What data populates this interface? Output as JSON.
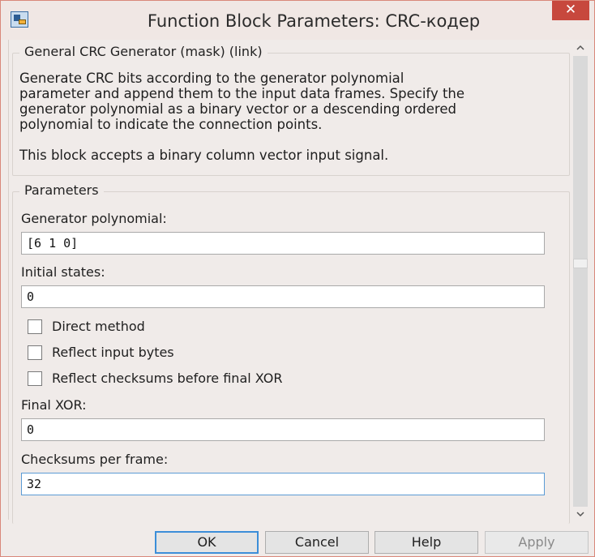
{
  "window": {
    "title": "Function Block Parameters: CRC-кодер",
    "close_label": "✕"
  },
  "mask_group": {
    "title": "General CRC Generator (mask) (link)",
    "description_lines": [
      "Generate CRC bits according to the generator polynomial",
      "parameter and append them to the input data frames. Specify the",
      "generator polynomial as a binary vector or a descending ordered",
      "polynomial to indicate the connection points."
    ],
    "note": "This block accepts a binary column vector input signal."
  },
  "parameters": {
    "title": "Parameters",
    "generator_polynomial": {
      "label": "Generator polynomial:",
      "value": "[6 1 0]"
    },
    "initial_states": {
      "label": "Initial states:",
      "value": "0"
    },
    "direct_method": {
      "label": "Direct method",
      "checked": false
    },
    "reflect_input_bytes": {
      "label": "Reflect input bytes",
      "checked": false
    },
    "reflect_checksums": {
      "label": "Reflect checksums before final XOR",
      "checked": false
    },
    "final_xor": {
      "label": "Final XOR:",
      "value": "0"
    },
    "checksums_per_frame": {
      "label": "Checksums per frame:",
      "value": "32"
    }
  },
  "buttons": {
    "ok": "OK",
    "cancel": "Cancel",
    "help": "Help",
    "apply": "Apply"
  },
  "colors": {
    "close_button": "#c7483d",
    "active_input_border": "#5b9bd5",
    "default_button_border": "#3c8ed8"
  }
}
